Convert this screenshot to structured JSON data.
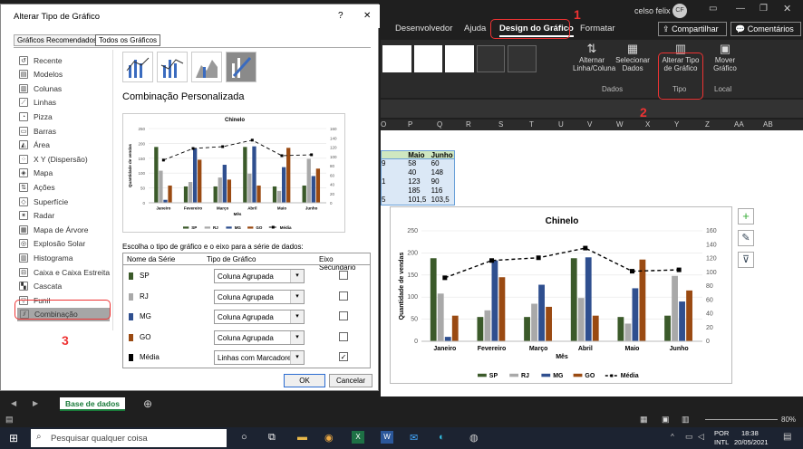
{
  "excel": {
    "user": "celso felix",
    "user_initials": "CF",
    "ribbon_tabs": [
      "Desenvolvedor",
      "Ajuda",
      "Design do Gráfico",
      "Formatar"
    ],
    "share_label": "Compartilhar",
    "comments_label": "Comentários",
    "ribbon_buttons": {
      "switch_row_col": "Alternar\nLinha/Coluna",
      "select_data": "Selecionar\nDados",
      "change_chart_type": "Alterar Tipo\nde Gráfico",
      "move_chart": "Mover\nGráfico"
    },
    "groups": {
      "dados": "Dados",
      "tipo": "Tipo",
      "local": "Local"
    },
    "columns": [
      "O",
      "P",
      "Q",
      "R",
      "S",
      "T",
      "U",
      "V",
      "W",
      "X",
      "Y",
      "Z",
      "AA",
      "AB"
    ],
    "sheet_tab": "Base de dados",
    "zoom": "80%",
    "lang": "POR",
    "layout": "INTL",
    "time": "18:38",
    "date": "20/05/2021",
    "search_placeholder": "Pesquisar qualquer coisa",
    "table": {
      "headers": [
        "Maio",
        "Junho"
      ],
      "rows": [
        [
          "58",
          "60"
        ],
        [
          "40",
          "148"
        ],
        [
          "123",
          "90"
        ],
        [
          "185",
          "116"
        ],
        [
          "101,5",
          "103,5"
        ]
      ],
      "row_prefix": [
        "9",
        "",
        "1",
        "",
        "5"
      ]
    }
  },
  "dialog": {
    "title": "Alterar Tipo de Gráfico",
    "help": "?",
    "close": "✕",
    "tab_recommended": "Gráficos Recomendados",
    "tab_all": "Todos os Gráficos",
    "chart_types": [
      "Recente",
      "Modelos",
      "Colunas",
      "Linhas",
      "Pizza",
      "Barras",
      "Área",
      "X Y (Dispersão)",
      "Mapa",
      "Ações",
      "Superfície",
      "Radar",
      "Mapa de Árvore",
      "Explosão Solar",
      "Histograma",
      "Caixa e Caixa Estreita",
      "Cascata",
      "Funil",
      "Combinação"
    ],
    "section_title": "Combinação Personalizada",
    "series_hint": "Escolha o tipo de gráfico e o eixo para a série de dados:",
    "col_series": "Nome da Série",
    "col_type": "Tipo de Gráfico",
    "col_axis": "Eixo Secundário",
    "series": [
      {
        "name": "SP",
        "type": "Coluna Agrupada",
        "secondary": false,
        "color": "#3b5a2a"
      },
      {
        "name": "RJ",
        "type": "Coluna Agrupada",
        "secondary": false,
        "color": "#a9a9a9"
      },
      {
        "name": "MG",
        "type": "Coluna Agrupada",
        "secondary": false,
        "color": "#2f4f8f"
      },
      {
        "name": "GO",
        "type": "Coluna Agrupada",
        "secondary": false,
        "color": "#9a4a12"
      },
      {
        "name": "Média",
        "type": "Linhas com Marcadores",
        "secondary": true,
        "color": "#000000"
      }
    ],
    "ok": "OK",
    "cancel": "Cancelar"
  },
  "annotations": [
    "1",
    "2",
    "3"
  ],
  "chart_data": {
    "type": "bar",
    "title": "Chinelo",
    "xlabel": "Mês",
    "ylabel": "Quantidade de vendas",
    "categories": [
      "Janeiro",
      "Fevereiro",
      "Março",
      "Abril",
      "Maio",
      "Junho"
    ],
    "ylim": [
      0,
      250
    ],
    "y2lim": [
      0,
      160
    ],
    "yticks": [
      0,
      50,
      100,
      150,
      200,
      250
    ],
    "y2ticks": [
      0,
      20,
      40,
      60,
      80,
      100,
      120,
      140,
      160
    ],
    "series": [
      {
        "name": "SP",
        "values": [
          188,
          55,
          55,
          188,
          55,
          58
        ],
        "color": "#3b5a2a"
      },
      {
        "name": "RJ",
        "values": [
          108,
          70,
          85,
          98,
          40,
          148
        ],
        "color": "#a9a9a9"
      },
      {
        "name": "MG",
        "values": [
          10,
          183,
          128,
          190,
          120,
          90
        ],
        "color": "#2f4f8f"
      },
      {
        "name": "GO",
        "values": [
          58,
          145,
          78,
          58,
          185,
          115
        ],
        "color": "#9a4a12"
      },
      {
        "name": "Média",
        "values": [
          92,
          117,
          121,
          135,
          101.5,
          103.5
        ],
        "color": "#000000",
        "axis": "secondary",
        "style": "dashed-line-markers"
      }
    ]
  }
}
